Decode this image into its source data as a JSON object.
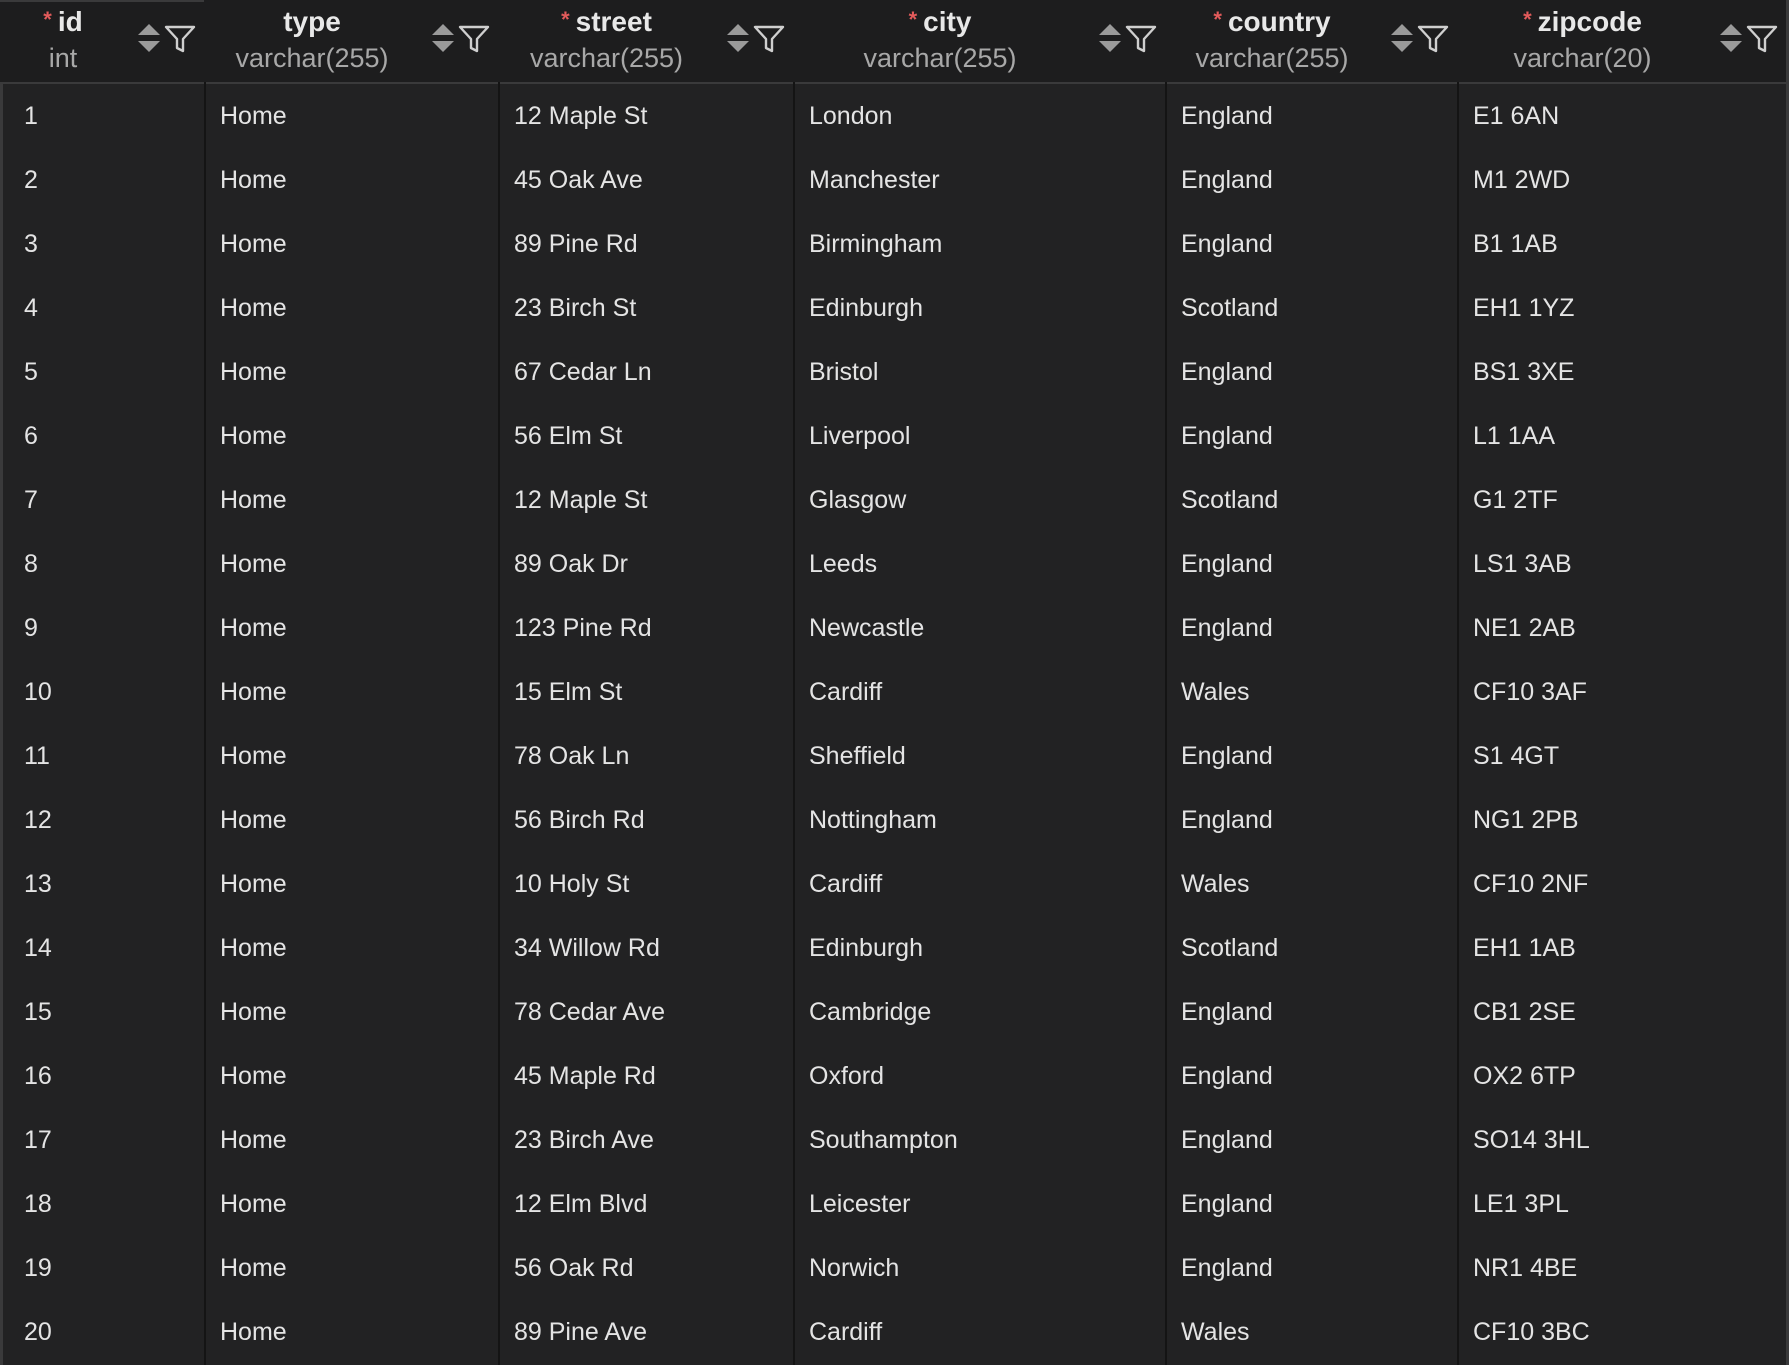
{
  "colors": {
    "background": "#222223",
    "header_background": "#1d1d1e",
    "required_marker": "#e25b5b",
    "text": "#e4e4e4",
    "type_text": "#a8a8a8"
  },
  "columns": [
    {
      "key": "id",
      "name": "id",
      "type": "int",
      "required": true,
      "required_marker": "*"
    },
    {
      "key": "type",
      "name": "type",
      "type": "varchar(255)",
      "required": false,
      "required_marker": ""
    },
    {
      "key": "street",
      "name": "street",
      "type": "varchar(255)",
      "required": true,
      "required_marker": "*"
    },
    {
      "key": "city",
      "name": "city",
      "type": "varchar(255)",
      "required": true,
      "required_marker": "*"
    },
    {
      "key": "country",
      "name": "country",
      "type": "varchar(255)",
      "required": true,
      "required_marker": "*"
    },
    {
      "key": "zipcode",
      "name": "zipcode",
      "type": "varchar(20)",
      "required": true,
      "required_marker": "*"
    }
  ],
  "rows": [
    {
      "id": "1",
      "type": "Home",
      "street": "12 Maple St",
      "city": "London",
      "country": "England",
      "zipcode": "E1 6AN"
    },
    {
      "id": "2",
      "type": "Home",
      "street": "45 Oak Ave",
      "city": "Manchester",
      "country": "England",
      "zipcode": "M1 2WD"
    },
    {
      "id": "3",
      "type": "Home",
      "street": "89 Pine Rd",
      "city": "Birmingham",
      "country": "England",
      "zipcode": "B1 1AB"
    },
    {
      "id": "4",
      "type": "Home",
      "street": "23 Birch St",
      "city": "Edinburgh",
      "country": "Scotland",
      "zipcode": "EH1 1YZ"
    },
    {
      "id": "5",
      "type": "Home",
      "street": "67 Cedar Ln",
      "city": "Bristol",
      "country": "England",
      "zipcode": "BS1 3XE"
    },
    {
      "id": "6",
      "type": "Home",
      "street": "56 Elm St",
      "city": "Liverpool",
      "country": "England",
      "zipcode": "L1 1AA"
    },
    {
      "id": "7",
      "type": "Home",
      "street": "12 Maple St",
      "city": "Glasgow",
      "country": "Scotland",
      "zipcode": "G1 2TF"
    },
    {
      "id": "8",
      "type": "Home",
      "street": "89 Oak Dr",
      "city": "Leeds",
      "country": "England",
      "zipcode": "LS1 3AB"
    },
    {
      "id": "9",
      "type": "Home",
      "street": "123 Pine Rd",
      "city": "Newcastle",
      "country": "England",
      "zipcode": "NE1 2AB"
    },
    {
      "id": "10",
      "type": "Home",
      "street": "15 Elm St",
      "city": "Cardiff",
      "country": "Wales",
      "zipcode": "CF10 3AF"
    },
    {
      "id": "11",
      "type": "Home",
      "street": "78 Oak Ln",
      "city": "Sheffield",
      "country": "England",
      "zipcode": "S1 4GT"
    },
    {
      "id": "12",
      "type": "Home",
      "street": "56 Birch Rd",
      "city": "Nottingham",
      "country": "England",
      "zipcode": "NG1 2PB"
    },
    {
      "id": "13",
      "type": "Home",
      "street": "10 Holy St",
      "city": "Cardiff",
      "country": "Wales",
      "zipcode": "CF10 2NF"
    },
    {
      "id": "14",
      "type": "Home",
      "street": "34 Willow Rd",
      "city": "Edinburgh",
      "country": "Scotland",
      "zipcode": "EH1 1AB"
    },
    {
      "id": "15",
      "type": "Home",
      "street": "78 Cedar Ave",
      "city": "Cambridge",
      "country": "England",
      "zipcode": "CB1 2SE"
    },
    {
      "id": "16",
      "type": "Home",
      "street": "45 Maple Rd",
      "city": "Oxford",
      "country": "England",
      "zipcode": "OX2 6TP"
    },
    {
      "id": "17",
      "type": "Home",
      "street": "23 Birch Ave",
      "city": "Southampton",
      "country": "England",
      "zipcode": "SO14 3HL"
    },
    {
      "id": "18",
      "type": "Home",
      "street": "12 Elm Blvd",
      "city": "Leicester",
      "country": "England",
      "zipcode": "LE1 3PL"
    },
    {
      "id": "19",
      "type": "Home",
      "street": "56 Oak Rd",
      "city": "Norwich",
      "country": "England",
      "zipcode": "NR1 4BE"
    },
    {
      "id": "20",
      "type": "Home",
      "street": "89 Pine Ave",
      "city": "Cardiff",
      "country": "Wales",
      "zipcode": "CF10 3BC"
    }
  ],
  "icons": {
    "sort": "sort-icon",
    "filter": "filter-icon"
  }
}
